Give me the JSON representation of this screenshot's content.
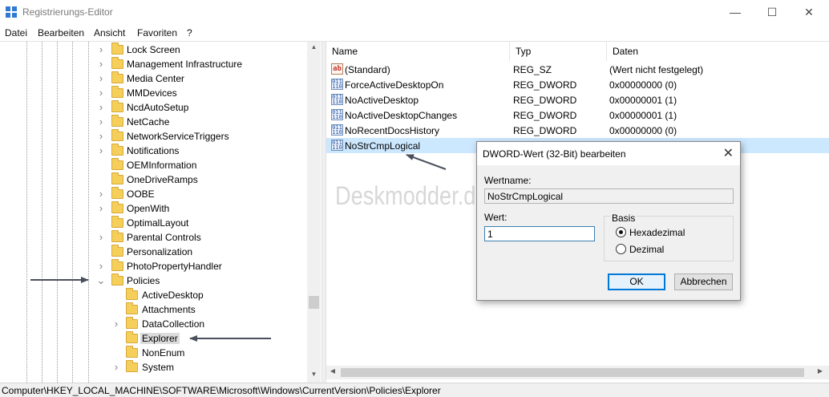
{
  "window": {
    "title": "Registrierungs-Editor",
    "min_glyph": "—",
    "max_glyph": "☐",
    "close_glyph": "✕"
  },
  "menu": [
    "Datei",
    "Bearbeiten",
    "Ansicht",
    "Favoriten",
    "?"
  ],
  "tree": {
    "items": [
      {
        "label": "Lock Screen",
        "toggle": "›"
      },
      {
        "label": "Management Infrastructure",
        "toggle": "›"
      },
      {
        "label": "Media Center",
        "toggle": "›"
      },
      {
        "label": "MMDevices",
        "toggle": "›"
      },
      {
        "label": "NcdAutoSetup",
        "toggle": "›"
      },
      {
        "label": "NetCache",
        "toggle": "›"
      },
      {
        "label": "NetworkServiceTriggers",
        "toggle": "›"
      },
      {
        "label": "Notifications",
        "toggle": "›"
      },
      {
        "label": "OEMInformation",
        "toggle": ""
      },
      {
        "label": "OneDriveRamps",
        "toggle": ""
      },
      {
        "label": "OOBE",
        "toggle": "›"
      },
      {
        "label": "OpenWith",
        "toggle": "›"
      },
      {
        "label": "OptimalLayout",
        "toggle": ""
      },
      {
        "label": "Parental Controls",
        "toggle": "›"
      },
      {
        "label": "Personalization",
        "toggle": ""
      },
      {
        "label": "PhotoPropertyHandler",
        "toggle": "›"
      },
      {
        "label": "Policies",
        "toggle": "⌄"
      },
      {
        "label": "ActiveDesktop",
        "toggle": ""
      },
      {
        "label": "Attachments",
        "toggle": ""
      },
      {
        "label": "DataCollection",
        "toggle": "›"
      },
      {
        "label": "Explorer",
        "toggle": "",
        "selected": true
      },
      {
        "label": "NonEnum",
        "toggle": ""
      },
      {
        "label": "System",
        "toggle": "›"
      }
    ]
  },
  "values": {
    "columns": [
      "Name",
      "Typ",
      "Daten"
    ],
    "rows": [
      {
        "name": "(Standard)",
        "type": "REG_SZ",
        "data": "(Wert nicht festgelegt)",
        "icon": "string-value-icon",
        "glyph": "ab"
      },
      {
        "name": "ForceActiveDesktopOn",
        "type": "REG_DWORD",
        "data": "0x00000000 (0)",
        "icon": "dword-value-icon",
        "glyph": "011\n110"
      },
      {
        "name": "NoActiveDesktop",
        "type": "REG_DWORD",
        "data": "0x00000001 (1)",
        "icon": "dword-value-icon",
        "glyph": "011\n110"
      },
      {
        "name": "NoActiveDesktopChanges",
        "type": "REG_DWORD",
        "data": "0x00000001 (1)",
        "icon": "dword-value-icon",
        "glyph": "011\n110"
      },
      {
        "name": "NoRecentDocsHistory",
        "type": "REG_DWORD",
        "data": "0x00000000 (0)",
        "icon": "dword-value-icon",
        "glyph": "011\n110"
      },
      {
        "name": "NoStrCmpLogical",
        "type": "",
        "data": "",
        "icon": "dword-value-icon",
        "glyph": "011\n110",
        "selected": true
      }
    ]
  },
  "dialog": {
    "title": "DWORD-Wert (32-Bit) bearbeiten",
    "close_glyph": "✕",
    "name_label": "Wertname:",
    "name_value": "NoStrCmpLogical",
    "value_label": "Wert:",
    "value": "1",
    "base_label": "Basis",
    "hex_label": "Hexadezimal",
    "dec_label": "Dezimal",
    "base_selected": "Hexadezimal",
    "ok_label": "OK",
    "cancel_label": "Abbrechen"
  },
  "watermark": "Deskmodder.de",
  "statusbar": {
    "path": "Computer\\HKEY_LOCAL_MACHINE\\SOFTWARE\\Microsoft\\Windows\\CurrentVersion\\Policies\\Explorer"
  },
  "colors": {
    "selection": "#cce8ff",
    "accent": "#0078d7",
    "folder": "#f5cf5a",
    "annotation_arrow": "#4a4f5c"
  }
}
